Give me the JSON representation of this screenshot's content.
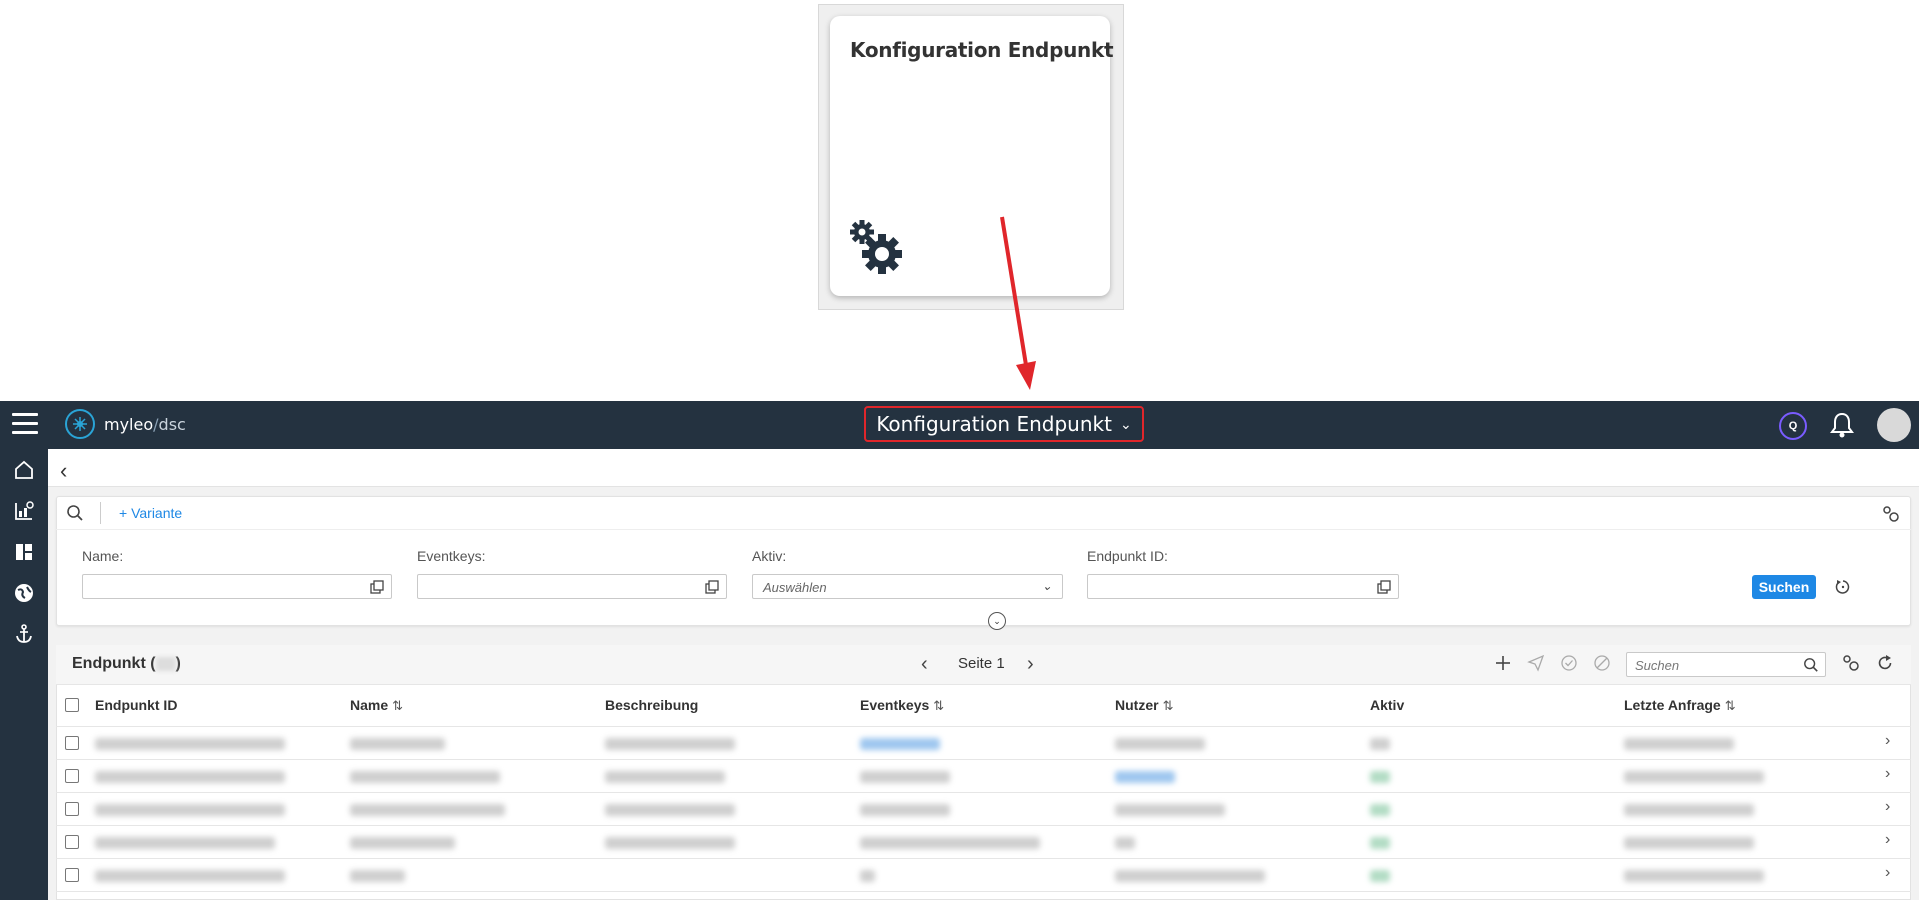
{
  "tile": {
    "title": "Konfiguration Endpunkt",
    "icon": "gears-icon"
  },
  "topbar": {
    "logo_main": "myleo",
    "logo_slash": "/",
    "logo_sub": "dsc",
    "title": "Konfiguration Endpunkt",
    "q_badge": "Q"
  },
  "filter": {
    "variante": "+ Variante",
    "fields": [
      {
        "label": "Name:"
      },
      {
        "label": "Eventkeys:"
      },
      {
        "label": "Aktiv:",
        "placeholder": "Auswählen"
      },
      {
        "label": "Endpunkt ID:"
      }
    ],
    "search_button": "Suchen"
  },
  "table": {
    "title": "Endpunkt (",
    "title_end": ")",
    "page_label": "Seite 1",
    "search_placeholder": "Suchen",
    "columns": [
      "Endpunkt ID",
      "Name",
      "Beschreibung",
      "Eventkeys",
      "Nutzer",
      "Aktiv",
      "Letzte Anfrage"
    ],
    "sortable": [
      false,
      true,
      false,
      true,
      true,
      false,
      true
    ],
    "row_count": 5
  },
  "colors": {
    "topbar": "#243240",
    "accent": "#1e88e5",
    "highlight_box": "#e0262b"
  }
}
